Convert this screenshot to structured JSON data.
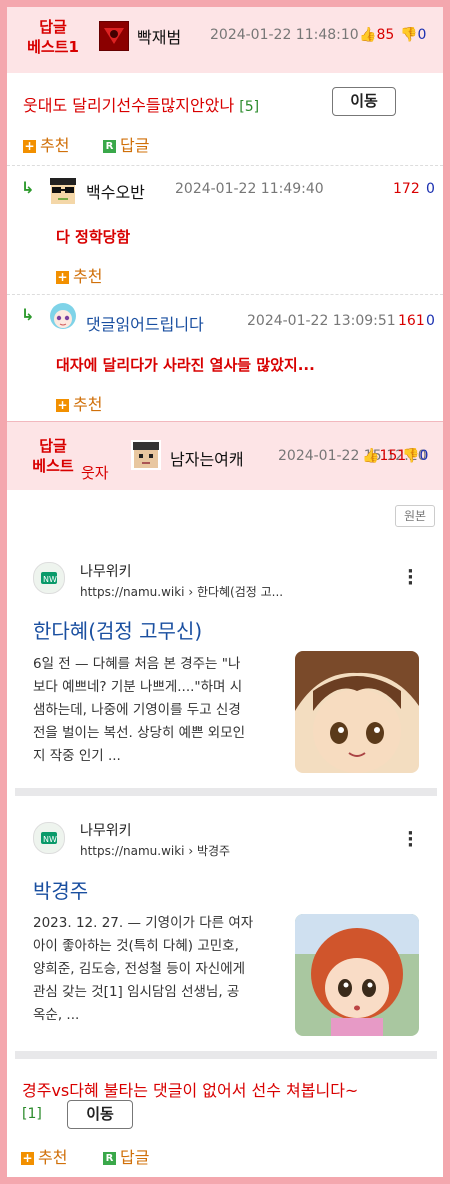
{
  "best1": {
    "badge_line1": "답글",
    "badge_line2": "베스트1",
    "nick": "빡재범",
    "date": "2024-01-22 11:48:10",
    "up": "85",
    "down": "0",
    "title": "웃대도 달리기선수들많지안았나",
    "reply_count": "[5]",
    "move_label": "이동",
    "recommend_label": "추천",
    "reply_label": "답글"
  },
  "replies": [
    {
      "arrow": "↳",
      "nick": "백수오반",
      "date": "2024-01-22 11:49:40",
      "up": "172",
      "down": "0",
      "text": "다 정학당함",
      "recommend_label": "추천"
    },
    {
      "arrow": "↳",
      "nick": "댓글읽어드립니다",
      "date": "2024-01-22 13:09:51",
      "up": "161",
      "down": "0",
      "text": "대자에 달리다가 사라진 열사들 많았지...",
      "recommend_label": "추천"
    }
  ],
  "best2": {
    "badge_line1": "답글",
    "badge_line2": "베스트",
    "tag": "웃자",
    "nick": "남자는여캐",
    "date": "2024-01-22 15:12:20",
    "up": "151",
    "down": "0",
    "original_label": "원본",
    "cards": [
      {
        "site": "나무위키",
        "url": "https://namu.wiki › 한다혜(검정 고...",
        "title": "한다혜(검정 고무신)",
        "lines": [
          "6일 전 — 다혜를 처음 본 경주는 \"나",
          "보다 예쁘네? 기분 나쁘게....\"하며 시",
          "샘하는데, 나중에 기영이를 두고 신경",
          "전을 벌이는 복선. 상당히 예쁜 외모인",
          "지 작중 인기 ..."
        ]
      },
      {
        "site": "나무위키",
        "url": "https://namu.wiki › 박경주",
        "title": "박경주",
        "lines": [
          "2023. 12. 27. — 기영이가 다른 여자",
          "아이 좋아하는 것(특히 다혜) 고민호,",
          "양희준, 김도승, 전성철 등이 자신에게",
          "관심 갖는 것[1] 임시담임 선생님, 공",
          "옥순, ..."
        ]
      }
    ],
    "comment_line1": "경주vs다혜 불타는 댓글이 없어서 선수 쳐봅니다~",
    "reply_count": "[1]",
    "move_label": "이동",
    "recommend_label": "추천",
    "reply_label": "답글"
  },
  "colors": {
    "border": "#f4a7ae",
    "header_bg": "#fde4e6",
    "accent_red": "#d80000",
    "accent_blue": "#1a2fb0"
  }
}
